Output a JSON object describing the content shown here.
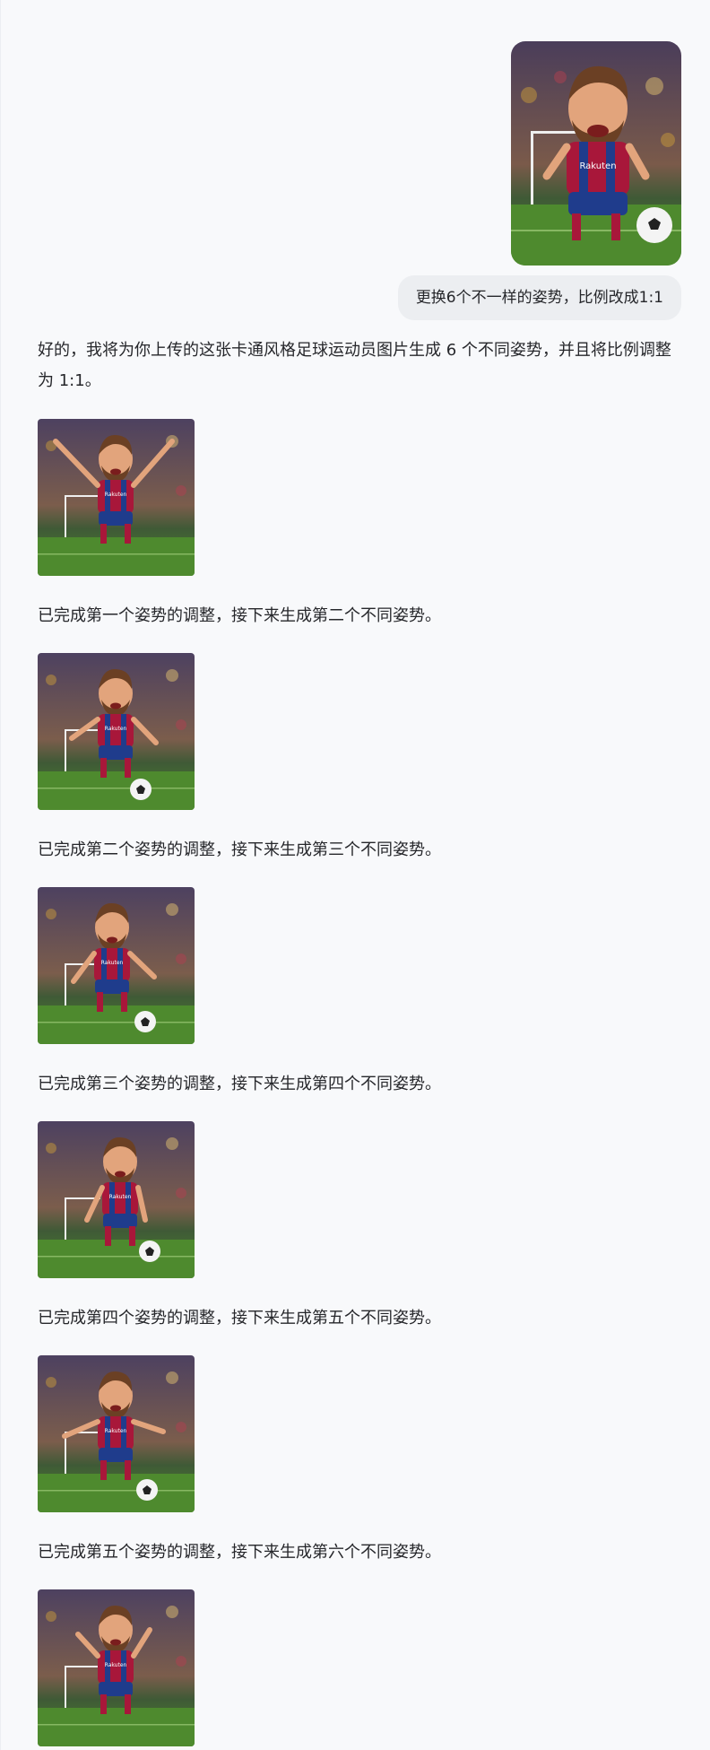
{
  "conversation": {
    "user_prompt": "更换6个不一样的姿势，比例改成1:1",
    "assistant_reply": "好的，我将为你上传的这张卡通风格足球运动员图片生成 6 个不同姿势，并且将比例调整为 1:1。",
    "jersey_sponsor": "Rakuten",
    "results": [
      {
        "pose": "arms-raised-running",
        "status": "已完成第一个姿势的调整，接下来生成第二个不同姿势。"
      },
      {
        "pose": "dribbling-ball",
        "status": "已完成第二个姿势的调整，接下来生成第三个不同姿势。"
      },
      {
        "pose": "running-with-ball",
        "status": "已完成第三个姿势的调整，接下来生成第四个不同姿势。"
      },
      {
        "pose": "standing-side-ball",
        "status": "已完成第四个姿势的调整，接下来生成第五个不同姿势。"
      },
      {
        "pose": "lunge-kick",
        "status": "已完成第五个姿势的调整，接下来生成第六个不同姿势。"
      },
      {
        "pose": "celebrating-arms-up",
        "status": ""
      }
    ]
  },
  "colors": {
    "background": "#f8f9fb",
    "bubble": "#eceef1",
    "text": "#26272b",
    "jersey_red": "#a8173a",
    "jersey_blue": "#1f3c8c",
    "grass": "#4e8a2e",
    "crowd": "#5b4a63"
  }
}
